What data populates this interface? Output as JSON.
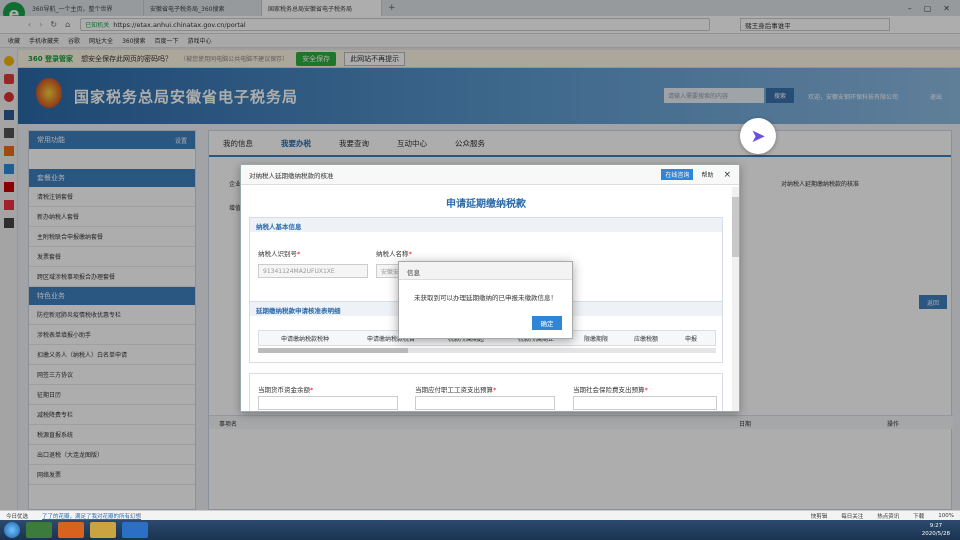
{
  "browser": {
    "tabs": [
      "360导航_一个主页，整个世界",
      "安徽省电子税务局_360搜索",
      "国家税务总局安徽省电子税务局"
    ],
    "address_prefix": "已知机关",
    "url": "https://etax.anhui.chinatax.gov.cn/portal",
    "search_text": "赌王身后事谁平",
    "bookmarks": [
      "收藏",
      "手机收藏夹",
      "谷歌",
      "网址大全",
      "360搜索",
      "百度一下",
      "游戏中心"
    ],
    "pw_logo": "360 登录管家",
    "pw_prompt": "想安全保存此网页的密码吗？",
    "pw_hint": "（被您使用同电脑公共电脑不建议保存）",
    "pw_save": "安全保存",
    "pw_never": "此网站不再提示"
  },
  "site": {
    "title": "国家税务总局安徽省电子税务局",
    "search_placeholder": "请输入需要搜索的内容",
    "search_btn": "搜索",
    "welcome": "欢迎，安徽安钢环保科技有限公司",
    "logout": "退出",
    "nav": [
      "我的信息",
      "我要办税",
      "我要查询",
      "互动中心",
      "公众服务"
    ],
    "bg_texts": [
      "企业所",
      "增值税",
      "对纳税人延期缴纳税款的核准",
      "返回",
      "我的",
      "事项名",
      "日期",
      "操作"
    ]
  },
  "sidebar": {
    "head": "常用功能",
    "settings": "设置",
    "section1": "套餐业务",
    "items1": [
      "清税注销套餐",
      "新办纳税人套餐",
      "主附税联合申报缴纳套餐",
      "发票套餐",
      "跨区域涉税事项报合办理套餐"
    ],
    "section2": "特色业务",
    "items2": [
      "防控新冠肺炎疫情税收优惠专栏",
      "涉税表单填报小助手",
      "扣缴义务人（纳税人）白名单申请",
      "网签三方协议",
      "征期日历",
      "减税降费专栏",
      "税源直报系统",
      "出口退税（大连龙图版）",
      "网络发票"
    ]
  },
  "dialog": {
    "title": "对纳税人延期缴纳税款的核准",
    "online": "在线咨询",
    "help": "帮助",
    "form_title": "申请延期缴纳税款",
    "section_basic": "纳税人基本信息",
    "taxpayer_id_label": "纳税人识别号",
    "taxpayer_id_value": "91341124MA2UFUX1XE",
    "taxpayer_name_label": "纳税人名称",
    "taxpayer_name_value": "安徽安",
    "section_apply": "延期缴纳税款申请核准表明细",
    "table_headers": [
      "申请缴纳税款税种",
      "申请缴纳税款税目",
      "税款所属期起",
      "税款所属期止",
      "限缴期限",
      "应缴税额",
      "申报"
    ],
    "label_cash": "当期货币资金余额",
    "label_wage": "当期应付职工工资支出预算",
    "label_social": "当期社会保险费支出预算"
  },
  "alert": {
    "title": "信息",
    "message": "未获取到可以办理延期缴纳的已申报未缴款信息！",
    "ok": "确定"
  },
  "statusbar": {
    "left": "今日优选",
    "link": "了了的花瓣，满足了我对花瓣的所有幻想",
    "right": [
      "快剪辑",
      "每日关注",
      "热点资讯",
      "下载",
      "100%"
    ]
  },
  "taskbar": {
    "time": "9:27",
    "date": "2020/5/28"
  }
}
